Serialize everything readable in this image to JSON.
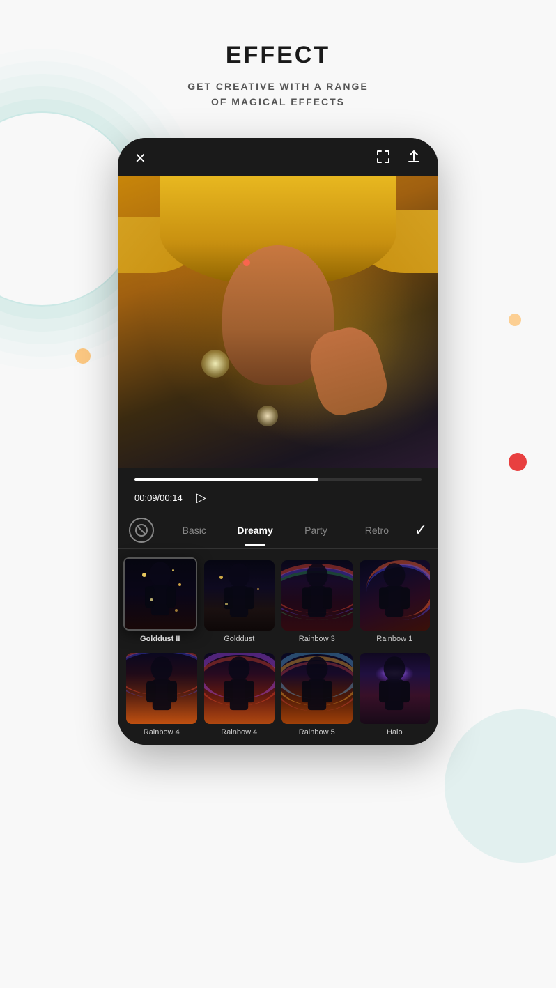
{
  "header": {
    "title": "EFFECT",
    "subtitle_line1": "GET CREATIVE WITH A RANGE",
    "subtitle_line2": "OF MAGICAL EFFECTS"
  },
  "player": {
    "time_current": "00:09",
    "time_total": "00:14",
    "time_separator": "/",
    "play_icon": "▷"
  },
  "tabs": {
    "no_effect_icon": "⊘",
    "items": [
      {
        "label": "Basic",
        "active": false
      },
      {
        "label": "Dreamy",
        "active": true
      },
      {
        "label": "Party",
        "active": false
      },
      {
        "label": "Retro",
        "active": false
      }
    ],
    "confirm_icon": "✓"
  },
  "effects_row1": [
    {
      "label": "Golddust II",
      "selected": true,
      "type": "golddust2"
    },
    {
      "label": "Golddust",
      "selected": false,
      "type": "golddust"
    },
    {
      "label": "Rainbow 3",
      "selected": false,
      "type": "rainbow3"
    },
    {
      "label": "Rainbow 1",
      "selected": false,
      "type": "rainbow1"
    }
  ],
  "effects_row2": [
    {
      "label": "Rainbow 4",
      "selected": false,
      "type": "rainbow4a"
    },
    {
      "label": "Rainbow 4",
      "selected": false,
      "type": "rainbow4b"
    },
    {
      "label": "Rainbow 5",
      "selected": false,
      "type": "rainbow5"
    },
    {
      "label": "Halo",
      "selected": false,
      "type": "halo"
    }
  ],
  "icons": {
    "close": "✕",
    "fullscreen": "⛶",
    "share": "↑"
  }
}
